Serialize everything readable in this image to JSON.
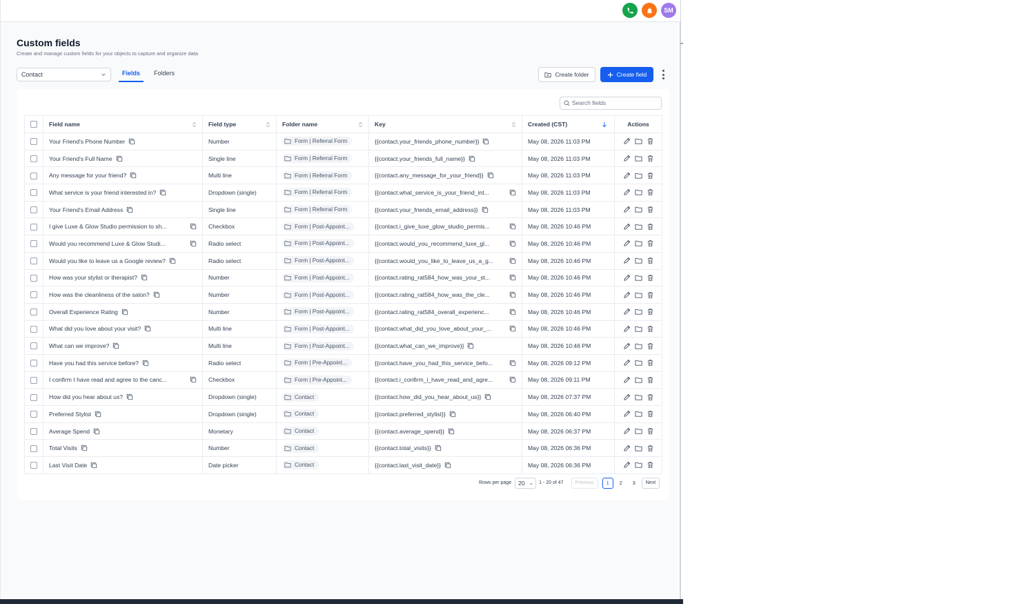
{
  "header": {
    "avatar_initials": "SM",
    "colors": {
      "phone": "#16a34a",
      "bell": "#f97316",
      "avatar": "#9f7aea",
      "accent": "#155eef"
    }
  },
  "page": {
    "title": "Custom fields",
    "subtitle": "Create and manage custom fields for your objects to capture and organize data"
  },
  "object_select": {
    "value": "Contact"
  },
  "tabs": [
    {
      "label": "Fields",
      "active": true
    },
    {
      "label": "Folders",
      "active": false
    }
  ],
  "toolbar": {
    "create_folder_label": "Create folder",
    "create_field_label": "Create field"
  },
  "search": {
    "placeholder": "Search fields"
  },
  "table": {
    "columns": {
      "field_name": "Field name",
      "field_type": "Field type",
      "folder_name": "Folder name",
      "key": "Key",
      "created": "Created (CST)",
      "actions": "Actions"
    },
    "rows": [
      {
        "name": "Your Friend's Phone Number",
        "type": "Number",
        "folder": "Form | Referral Form",
        "key": "{{contact.your_friends_phone_number}}",
        "created": "May 08, 2026 11:03 PM"
      },
      {
        "name": "Your Friend's Full Name",
        "type": "Single line",
        "folder": "Form | Referral Form",
        "key": "{{contact.your_friends_full_name}}",
        "created": "May 08, 2026 11:03 PM"
      },
      {
        "name": "Any message for your friend?",
        "type": "Multi line",
        "folder": "Form | Referral Form",
        "key": "{{contact.any_message_for_your_friend}}",
        "created": "May 08, 2026 11:03 PM"
      },
      {
        "name": "What service is your friend interested in?",
        "type": "Dropdown (single)",
        "folder": "Form | Referral Form",
        "key": "{{contact.what_service_is_your_friend_int...",
        "created": "May 08, 2026 11:03 PM"
      },
      {
        "name": "Your Friend's Email Address",
        "type": "Single line",
        "folder": "Form | Referral Form",
        "key": "{{contact.your_friends_email_address}}",
        "created": "May 08, 2026 11:03 PM"
      },
      {
        "name": "I give Luxe & Glow Studio permission to sh...",
        "type": "Checkbox",
        "folder": "Form | Post-Appoint...",
        "key": "{{contact.i_give_luxe_glow_studio_permis...",
        "created": "May 08, 2026 10:46 PM"
      },
      {
        "name": "Would you recommend Luxe & Glow Studi...",
        "type": "Radio select",
        "folder": "Form | Post-Appoint...",
        "key": "{{contact.would_you_recommend_luxe_gl...",
        "created": "May 08, 2026 10:46 PM"
      },
      {
        "name": "Would you like to leave us a Google review?",
        "type": "Radio select",
        "folder": "Form | Post-Appoint...",
        "key": "{{contact.would_you_like_to_leave_us_a_g...",
        "created": "May 08, 2026 10:46 PM"
      },
      {
        "name": "How was your stylist or therapist?",
        "type": "Number",
        "folder": "Form | Post-Appoint...",
        "key": "{{contact.rating_rat584_how_was_your_st...",
        "created": "May 08, 2026 10:46 PM"
      },
      {
        "name": "How was the cleanliness of the salon?",
        "type": "Number",
        "folder": "Form | Post-Appoint...",
        "key": "{{contact.rating_rat584_how_was_the_cle...",
        "created": "May 08, 2026 10:46 PM"
      },
      {
        "name": "Overall Experience Rating",
        "type": "Number",
        "folder": "Form | Post-Appoint...",
        "key": "{{contact.rating_rat584_overall_experienc...",
        "created": "May 08, 2026 10:46 PM"
      },
      {
        "name": "What did you love about your visit?",
        "type": "Multi line",
        "folder": "Form | Post-Appoint...",
        "key": "{{contact.what_did_you_love_about_your_...",
        "created": "May 08, 2026 10:46 PM"
      },
      {
        "name": "What can we improve?",
        "type": "Multi line",
        "folder": "Form | Post-Appoint...",
        "key": "{{contact.what_can_we_improve}}",
        "created": "May 08, 2026 10:46 PM"
      },
      {
        "name": "Have you had this service before?",
        "type": "Radio select",
        "folder": "Form | Pre-Appoint...",
        "key": "{{contact.have_you_had_this_service_befo...",
        "created": "May 08, 2026 09:12 PM"
      },
      {
        "name": "I confirm I have read and agree to the canc...",
        "type": "Checkbox",
        "folder": "Form | Pre-Appoint...",
        "key": "{{contact.i_confirm_i_have_read_and_agre...",
        "created": "May 08, 2026 09:11 PM"
      },
      {
        "name": "How did you hear about us?",
        "type": "Dropdown (single)",
        "folder": "Contact",
        "key": "{{contact.how_did_you_hear_about_us}}",
        "created": "May 08, 2026 07:37 PM"
      },
      {
        "name": "Preferred Stylist",
        "type": "Dropdown (single)",
        "folder": "Contact",
        "key": "{{contact.preferred_stylist}}",
        "created": "May 08, 2026 06:40 PM"
      },
      {
        "name": "Average Spend",
        "type": "Monetary",
        "folder": "Contact",
        "key": "{{contact.average_spend}}",
        "created": "May 08, 2026 06:37 PM"
      },
      {
        "name": "Total Visits",
        "type": "Number",
        "folder": "Contact",
        "key": "{{contact.total_visits}}",
        "created": "May 08, 2026 06:36 PM"
      },
      {
        "name": "Last Visit Date",
        "type": "Date picker",
        "folder": "Contact",
        "key": "{{contact.last_visit_date}}",
        "created": "May 08, 2026 06:36 PM"
      }
    ]
  },
  "pagination": {
    "rows_per_page_label": "Rows per page",
    "rows_per_page_value": "20",
    "range": "1 - 20 of 47",
    "previous_label": "Previous",
    "next_label": "Next",
    "pages": [
      "1",
      "2",
      "3"
    ],
    "current_page": "1"
  }
}
